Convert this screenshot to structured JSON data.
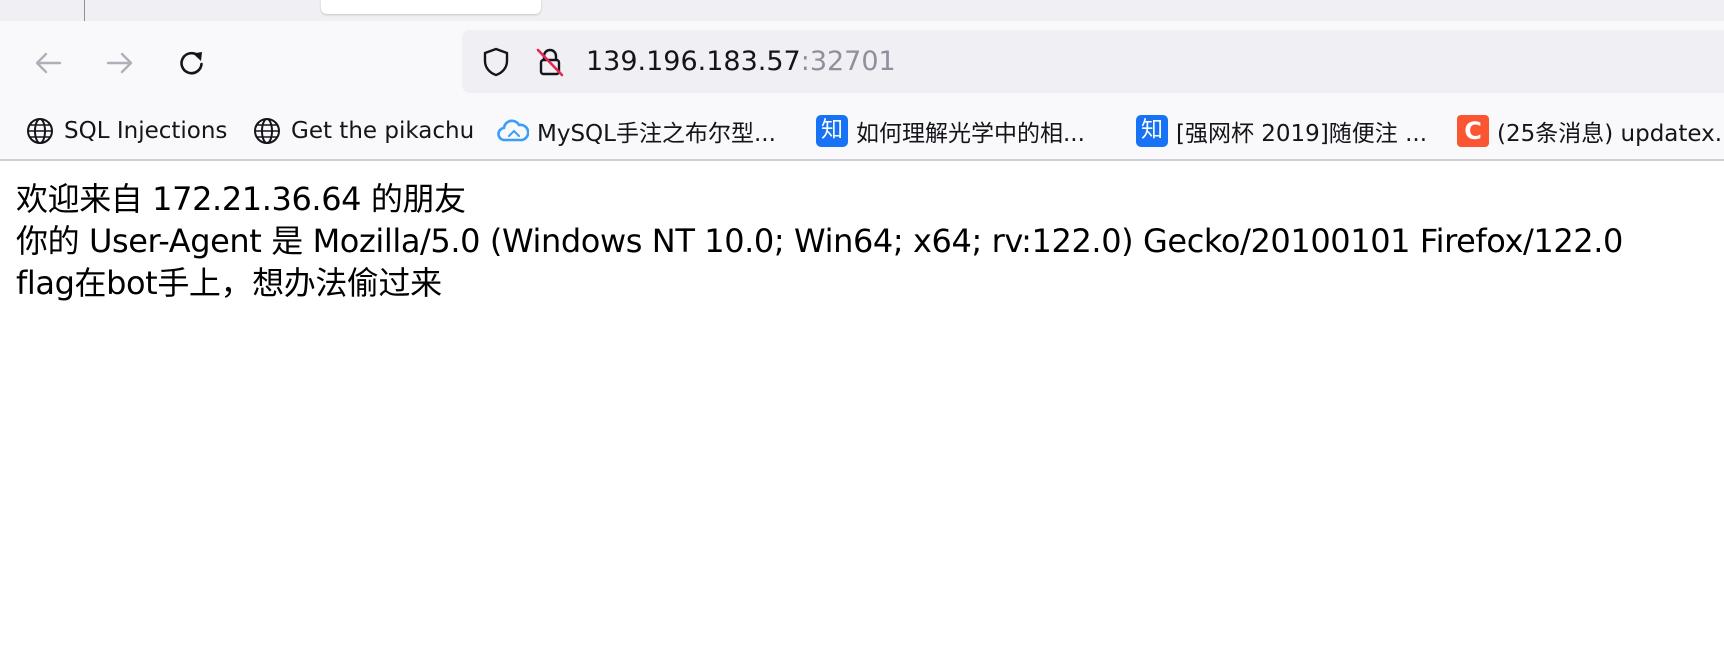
{
  "browser": {
    "url_host": "139.196.183.57",
    "url_port": ":32701"
  },
  "icons": {
    "back": "arrow-left-icon",
    "forward": "arrow-right-icon",
    "reload": "reload-icon",
    "tracking": "shield-icon",
    "insecure": "lock-strikethrough-icon",
    "bookmark_globe": "globe-icon",
    "bookmark_cloud": "cloud-icon",
    "bookmark_zhihu": "zhihu-icon",
    "bookmark_csdn": "csdn-icon"
  },
  "bookmarks": [
    {
      "label": "SQL Injections",
      "icon": "globe-icon"
    },
    {
      "label": "Get the pikachu",
      "icon": "globe-icon"
    },
    {
      "label": "MySQL手注之布尔型...",
      "icon": "cloud-icon"
    },
    {
      "label": "如何理解光学中的相...",
      "icon": "zhihu-icon",
      "icon_text": "知"
    },
    {
      "label": "[强网杯 2019]随便注 ...",
      "icon": "zhihu-icon",
      "icon_text": "知"
    },
    {
      "label": "(25条消息) updatex...",
      "icon": "csdn-icon",
      "icon_text": "C"
    }
  ],
  "page": {
    "lines": [
      "欢迎来自 172.21.36.64 的朋友",
      "你的 User-Agent 是 Mozilla/5.0 (Windows NT 10.0; Win64; x64; rv:122.0) Gecko/20100101 Firefox/122.0",
      "flag在bot手上，想办法偷过来"
    ]
  },
  "colors": {
    "toolbar_bg": "#f9f9fb",
    "tabstrip_bg": "#f0f0f4",
    "urlbar_bg": "#f0f0f4",
    "zhihu_blue": "#1772f6",
    "csdn_red": "#fc5531",
    "insecure_strike": "#e22850",
    "cloud_blue": "#3b9ef7"
  }
}
